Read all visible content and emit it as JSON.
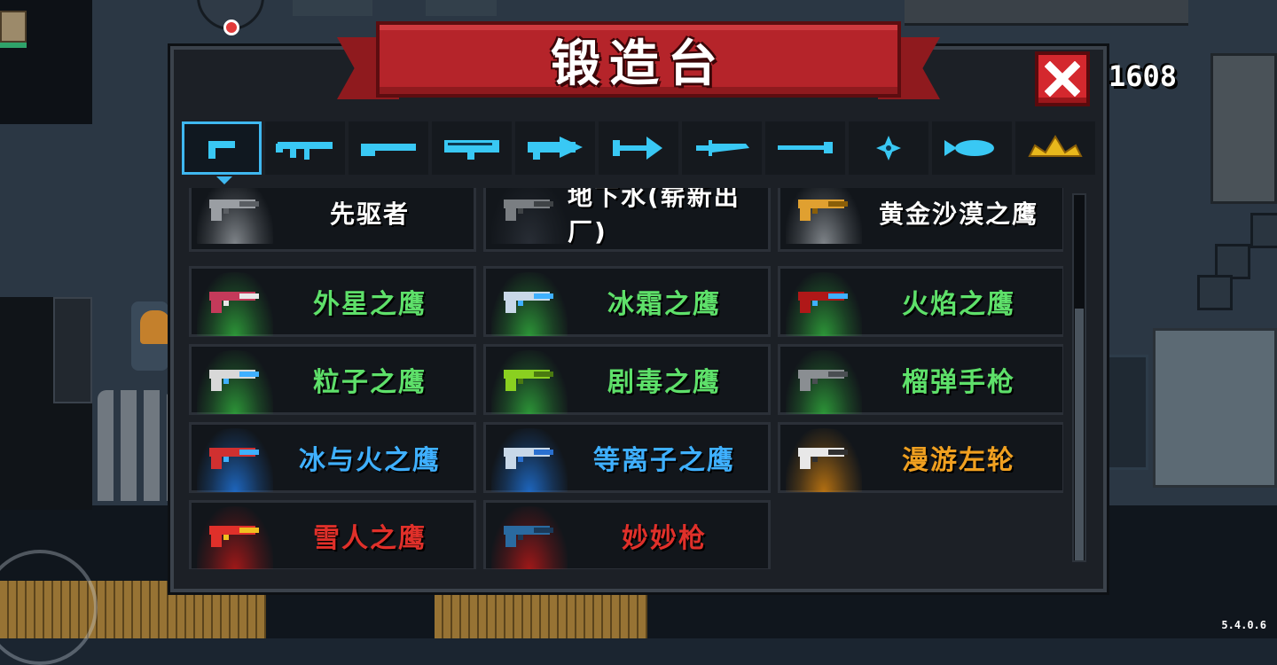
{
  "header": {
    "title": "锻造台",
    "gem_count": "1608"
  },
  "tabs": [
    {
      "icon": "pistol-icon",
      "active": true
    },
    {
      "icon": "assault-rifle-icon",
      "active": false
    },
    {
      "icon": "shotgun-icon",
      "active": false
    },
    {
      "icon": "rocket-launcher-icon",
      "active": false
    },
    {
      "icon": "laser-cannon-icon",
      "active": false
    },
    {
      "icon": "arrow-icon",
      "active": false
    },
    {
      "icon": "sword-icon",
      "active": false
    },
    {
      "icon": "staff-icon",
      "active": false
    },
    {
      "icon": "shuriken-icon",
      "active": false
    },
    {
      "icon": "fish-icon",
      "active": false
    },
    {
      "icon": "crown-icon",
      "active": false
    }
  ],
  "weapons": [
    {
      "name": "先驱者",
      "color": "#ffffff",
      "glow": "#8a8f94",
      "icon": "gray-pistol-icon"
    },
    {
      "name": "地下水(崭新出厂)",
      "color": "#ffffff",
      "glow": "#2b3038",
      "icon": "smg-icon"
    },
    {
      "name": "黄金沙漠之鹰",
      "color": "#ffffff",
      "glow": "#8a8f94",
      "icon": "golden-pistol-icon"
    },
    {
      "name": "外星之鹰",
      "color": "#5ee06a",
      "glow": "#2fa33a",
      "icon": "alien-pistol-icon"
    },
    {
      "name": "冰霜之鹰",
      "color": "#5ee06a",
      "glow": "#2fa33a",
      "icon": "frost-pistol-icon"
    },
    {
      "name": "火焰之鹰",
      "color": "#5ee06a",
      "glow": "#2fa33a",
      "icon": "flame-pistol-icon"
    },
    {
      "name": "粒子之鹰",
      "color": "#5ee06a",
      "glow": "#2fa33a",
      "icon": "particle-pistol-icon"
    },
    {
      "name": "剧毒之鹰",
      "color": "#5ee06a",
      "glow": "#2fa33a",
      "icon": "toxic-pistol-icon"
    },
    {
      "name": "榴弹手枪",
      "color": "#5ee06a",
      "glow": "#2fa33a",
      "icon": "grenade-pistol-icon"
    },
    {
      "name": "冰与火之鹰",
      "color": "#3fb0ff",
      "glow": "#1f6fd0",
      "icon": "ice-fire-pistol-icon"
    },
    {
      "name": "等离子之鹰",
      "color": "#3fb0ff",
      "glow": "#1f6fd0",
      "icon": "plasma-pistol-icon"
    },
    {
      "name": "漫游左轮",
      "color": "#f0a020",
      "glow": "#c67a10",
      "icon": "revolver-icon"
    },
    {
      "name": "雪人之鹰",
      "color": "#e0302a",
      "glow": "#b01818",
      "icon": "snowman-pistol-icon"
    },
    {
      "name": "妙妙枪",
      "color": "#e0302a",
      "glow": "#b01818",
      "icon": "turtle-gun-icon"
    }
  ],
  "version": "5.4.0.6",
  "scroll_position": 0.31
}
